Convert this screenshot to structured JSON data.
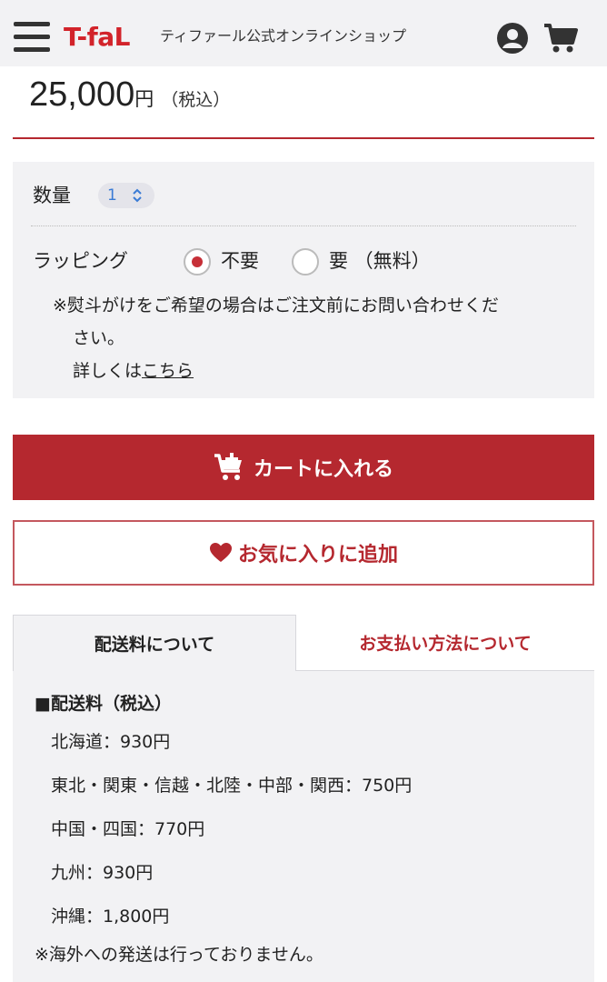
{
  "header": {
    "logo": "T-faL",
    "shop_name": "ティファール公式オンラインショップ"
  },
  "price": {
    "amount": "25,000",
    "currency": "円",
    "tax_note": "（税込）"
  },
  "options": {
    "quantity_label": "数量",
    "quantity_value": "1",
    "wrapping_label": "ラッピング",
    "wrapping_options": [
      {
        "label": "不要",
        "selected": true
      },
      {
        "label": "要 （無料）",
        "selected": false
      }
    ],
    "note_line1": "※熨斗がけをご希望の場合はご注文前にお問い合わせくだ",
    "note_line2": "さい。",
    "detail_prefix": "詳しくは",
    "detail_link": "こちら"
  },
  "buttons": {
    "cart": "カートに入れる",
    "favorite": "お気に入りに追加"
  },
  "tabs": [
    {
      "label": "配送料について",
      "active": true
    },
    {
      "label": "お支払い方法について",
      "active": false
    }
  ],
  "shipping": {
    "title": "■配送料（税込）",
    "rows": [
      "北海道：930円",
      "東北・関東・信越・北陸・中部・関西：750円",
      "中国・四国：770円",
      "九州：930円",
      "沖縄：1,800円"
    ],
    "note": "※海外への発送は行っておりません。"
  },
  "colors": {
    "brand_red": "#b5282f",
    "panel_bg": "#f2f2f4",
    "select_value": "#3a7bd5"
  }
}
